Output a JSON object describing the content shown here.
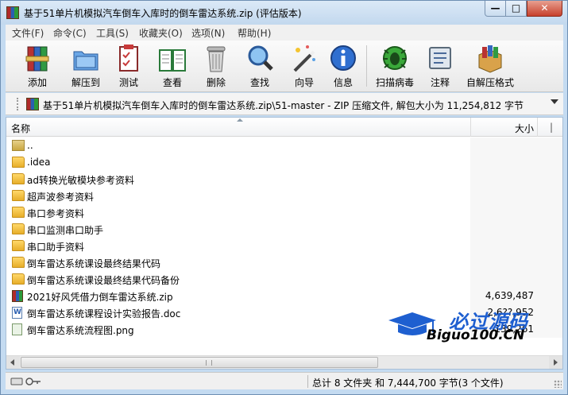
{
  "window": {
    "title": "基于51单片机模拟汽车倒车入库时的倒车雷达系统.zip (评估版本)",
    "controls": {
      "minimize": "—",
      "maximize": "□",
      "close": "✕"
    }
  },
  "menu": [
    "文件(F)",
    "命令(C)",
    "工具(S)",
    "收藏夹(O)",
    "选项(N)",
    "帮助(H)"
  ],
  "toolbar": [
    {
      "label": "添加",
      "icon": "archive-add-icon"
    },
    {
      "label": "解压到",
      "icon": "extract-folder-icon"
    },
    {
      "label": "测试",
      "icon": "test-checklist-icon"
    },
    {
      "label": "查看",
      "icon": "view-book-icon"
    },
    {
      "label": "删除",
      "icon": "trash-icon"
    },
    {
      "label": "查找",
      "icon": "magnifier-icon"
    },
    {
      "label": "向导",
      "icon": "wizard-wand-icon"
    },
    {
      "label": "信息",
      "icon": "info-icon"
    },
    {
      "label": "扫描病毒",
      "icon": "virus-scan-icon"
    },
    {
      "label": "注释",
      "icon": "comment-icon"
    },
    {
      "label": "自解压格式",
      "icon": "sfx-box-icon"
    }
  ],
  "address": {
    "path": "基于51单片机模拟汽车倒车入库时的倒车雷达系统.zip\\51-master - ZIP 压缩文件, 解包大小为 11,254,812 字节"
  },
  "columns": {
    "name": "名称",
    "size": "大小"
  },
  "files": [
    {
      "name": "..",
      "size": "",
      "type": "up"
    },
    {
      "name": ".idea",
      "size": "",
      "type": "folder"
    },
    {
      "name": "ad转换光敏模块参考资料",
      "size": "",
      "type": "folder"
    },
    {
      "name": "超声波参考资料",
      "size": "",
      "type": "folder"
    },
    {
      "name": "串口参考资料",
      "size": "",
      "type": "folder"
    },
    {
      "name": "串口监测串口助手",
      "size": "",
      "type": "folder"
    },
    {
      "name": "串口助手资料",
      "size": "",
      "type": "folder"
    },
    {
      "name": "倒车雷达系统课设最终结果代码",
      "size": "",
      "type": "folder"
    },
    {
      "name": "倒车雷达系统课设最终结果代码备份",
      "size": "",
      "type": "folder"
    },
    {
      "name": "2021好风凭借力倒车雷达系统.zip",
      "size": "4,639,487",
      "type": "zip"
    },
    {
      "name": "倒车雷达系统课程设计实验报告.doc",
      "size": "2,6??,952",
      "type": "doc"
    },
    {
      "name": "倒车雷达系统流程图.png",
      "size": "139,261",
      "type": "png"
    }
  ],
  "status": {
    "summary": "总计 8 文件夹 和 7,444,700 字节(3 个文件)"
  },
  "watermark": {
    "title": "必过源码",
    "subtitle": "Biguo100.CN"
  }
}
